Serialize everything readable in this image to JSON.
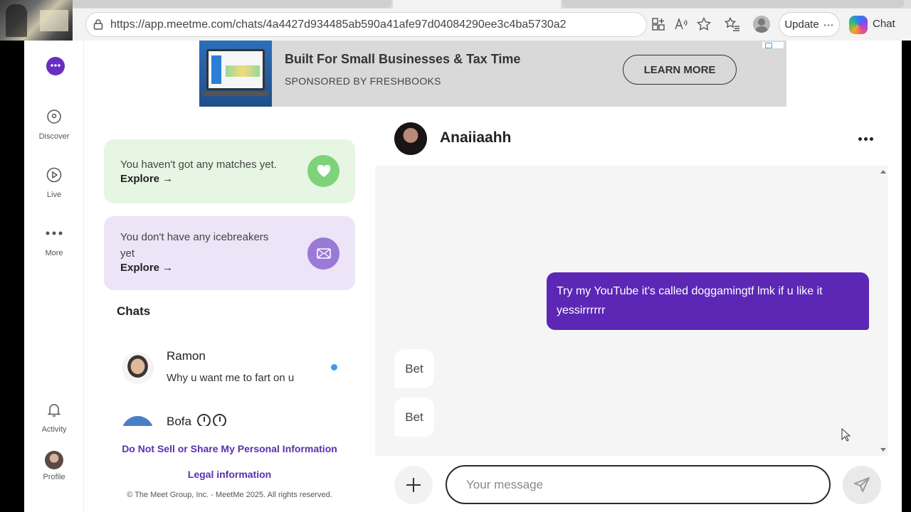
{
  "browser": {
    "url": "https://app.meetme.com/chats/4a4427d934485ab590a41afe97d04084290ee3c4ba5730a2",
    "update_label": "Update",
    "chat_label": "Chat"
  },
  "nav": {
    "discover": "Discover",
    "live": "Live",
    "more": "More",
    "activity": "Activity",
    "profile": "Profile"
  },
  "ad": {
    "title": "Built For Small Businesses & Tax Time",
    "sponsor": "SPONSORED BY FRESHBOOKS",
    "cta": "LEARN MORE"
  },
  "cards": {
    "matches_text": "You haven't got any matches yet.",
    "icebreakers_text": "You don't have any icebreakers yet",
    "explore": "Explore"
  },
  "chats": {
    "heading": "Chats",
    "items": [
      {
        "name": "Ramon",
        "preview": "Why u want me to fart on u",
        "unread": true
      },
      {
        "name": "Bofa",
        "preview": ""
      }
    ]
  },
  "footer": {
    "privacy": "Do Not Sell or Share My Personal Information",
    "legal": "Legal information",
    "copyright": "© The Meet Group, Inc. - MeetMe 2025. All rights reserved."
  },
  "conversation": {
    "contact_name": "Anaiiaahh",
    "messages": [
      {
        "from": "me",
        "text": "Try my YouTube it's called doggamingtf lmk if u like it yessirrrrrr"
      },
      {
        "from": "them",
        "text": "Bet"
      },
      {
        "from": "them",
        "text": "Bet"
      }
    ],
    "input_placeholder": "Your message"
  },
  "colors": {
    "brand_purple": "#5c27b5",
    "matches_card": "#e7f6e3",
    "icebreakers_card": "#ece4f7",
    "unread_dot": "#3b9bf0"
  }
}
